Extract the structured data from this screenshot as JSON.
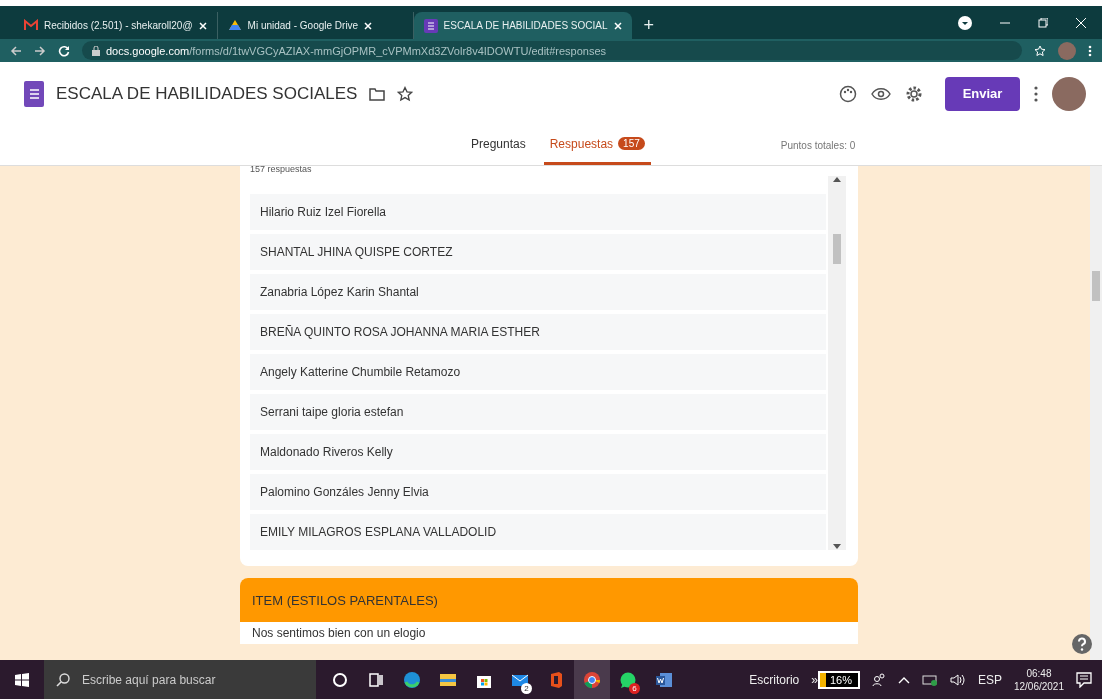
{
  "browser": {
    "tabs": [
      {
        "title": "Recibidos (2.501) - shekaroll20@",
        "kind": "mail",
        "selected": false
      },
      {
        "title": "Mi unidad - Google Drive",
        "kind": "drive",
        "selected": false
      },
      {
        "title": "ESCALA DE HABILIDADES SOCIAL",
        "kind": "forms",
        "selected": true
      }
    ],
    "new_tab": "+",
    "url_host": "docs.google.com",
    "url_path": "/forms/d/1twVGCyAZIAX-mmGjOPMR_cVPMmXd3ZVolr8v4IDOWTU/edit#responses"
  },
  "form": {
    "title": "ESCALA DE HABILIDADES SOCIALES",
    "send_button": "Enviar",
    "tabs": [
      {
        "label": "Preguntas",
        "selected": false
      },
      {
        "label": "Respuestas",
        "badge": "157",
        "selected": true
      }
    ],
    "points": "Puntos totales: 0"
  },
  "responses": {
    "count": "157 respuestas",
    "names": [
      "Hilario Ruiz Izel Fiorella",
      "SHANTAL JHINA QUISPE CORTEZ",
      "Zanabria López Karin Shantal",
      "BREÑA QUINTO ROSA JOHANNA MARIA ESTHER",
      "Angely Katterine Chumbile Retamozo",
      "Serrani taipe gloria estefan",
      "Maldonado Riveros Kelly",
      "Palomino Gonzáles Jenny Elvia",
      "EMILY MILAGROS ESPLANA VALLADOLID"
    ]
  },
  "section": {
    "title": "ITEM (ESTILOS PARENTALES)",
    "first_question": "Nos sentimos bien con un elogio"
  },
  "taskbar": {
    "search_placeholder": "Escribe aquí para buscar",
    "apps": [
      {
        "kind": "cortana",
        "selected": false
      },
      {
        "kind": "taskview",
        "selected": false
      },
      {
        "kind": "edge",
        "selected": false
      },
      {
        "kind": "explorer",
        "selected": false
      },
      {
        "kind": "store",
        "selected": false
      },
      {
        "kind": "mail",
        "badge": "2",
        "selected": false
      },
      {
        "kind": "office",
        "selected": false
      },
      {
        "kind": "chrome",
        "selected": true
      },
      {
        "kind": "whatsapp",
        "badge": "6",
        "selected": false
      },
      {
        "kind": "word",
        "selected": false
      }
    ],
    "desktop": "Escritorio",
    "chevron": "»",
    "battery": {
      "reading": "16%",
      "level": 0.16
    },
    "lang": "ESP",
    "time": "06:48",
    "date": "12/06/2021"
  }
}
